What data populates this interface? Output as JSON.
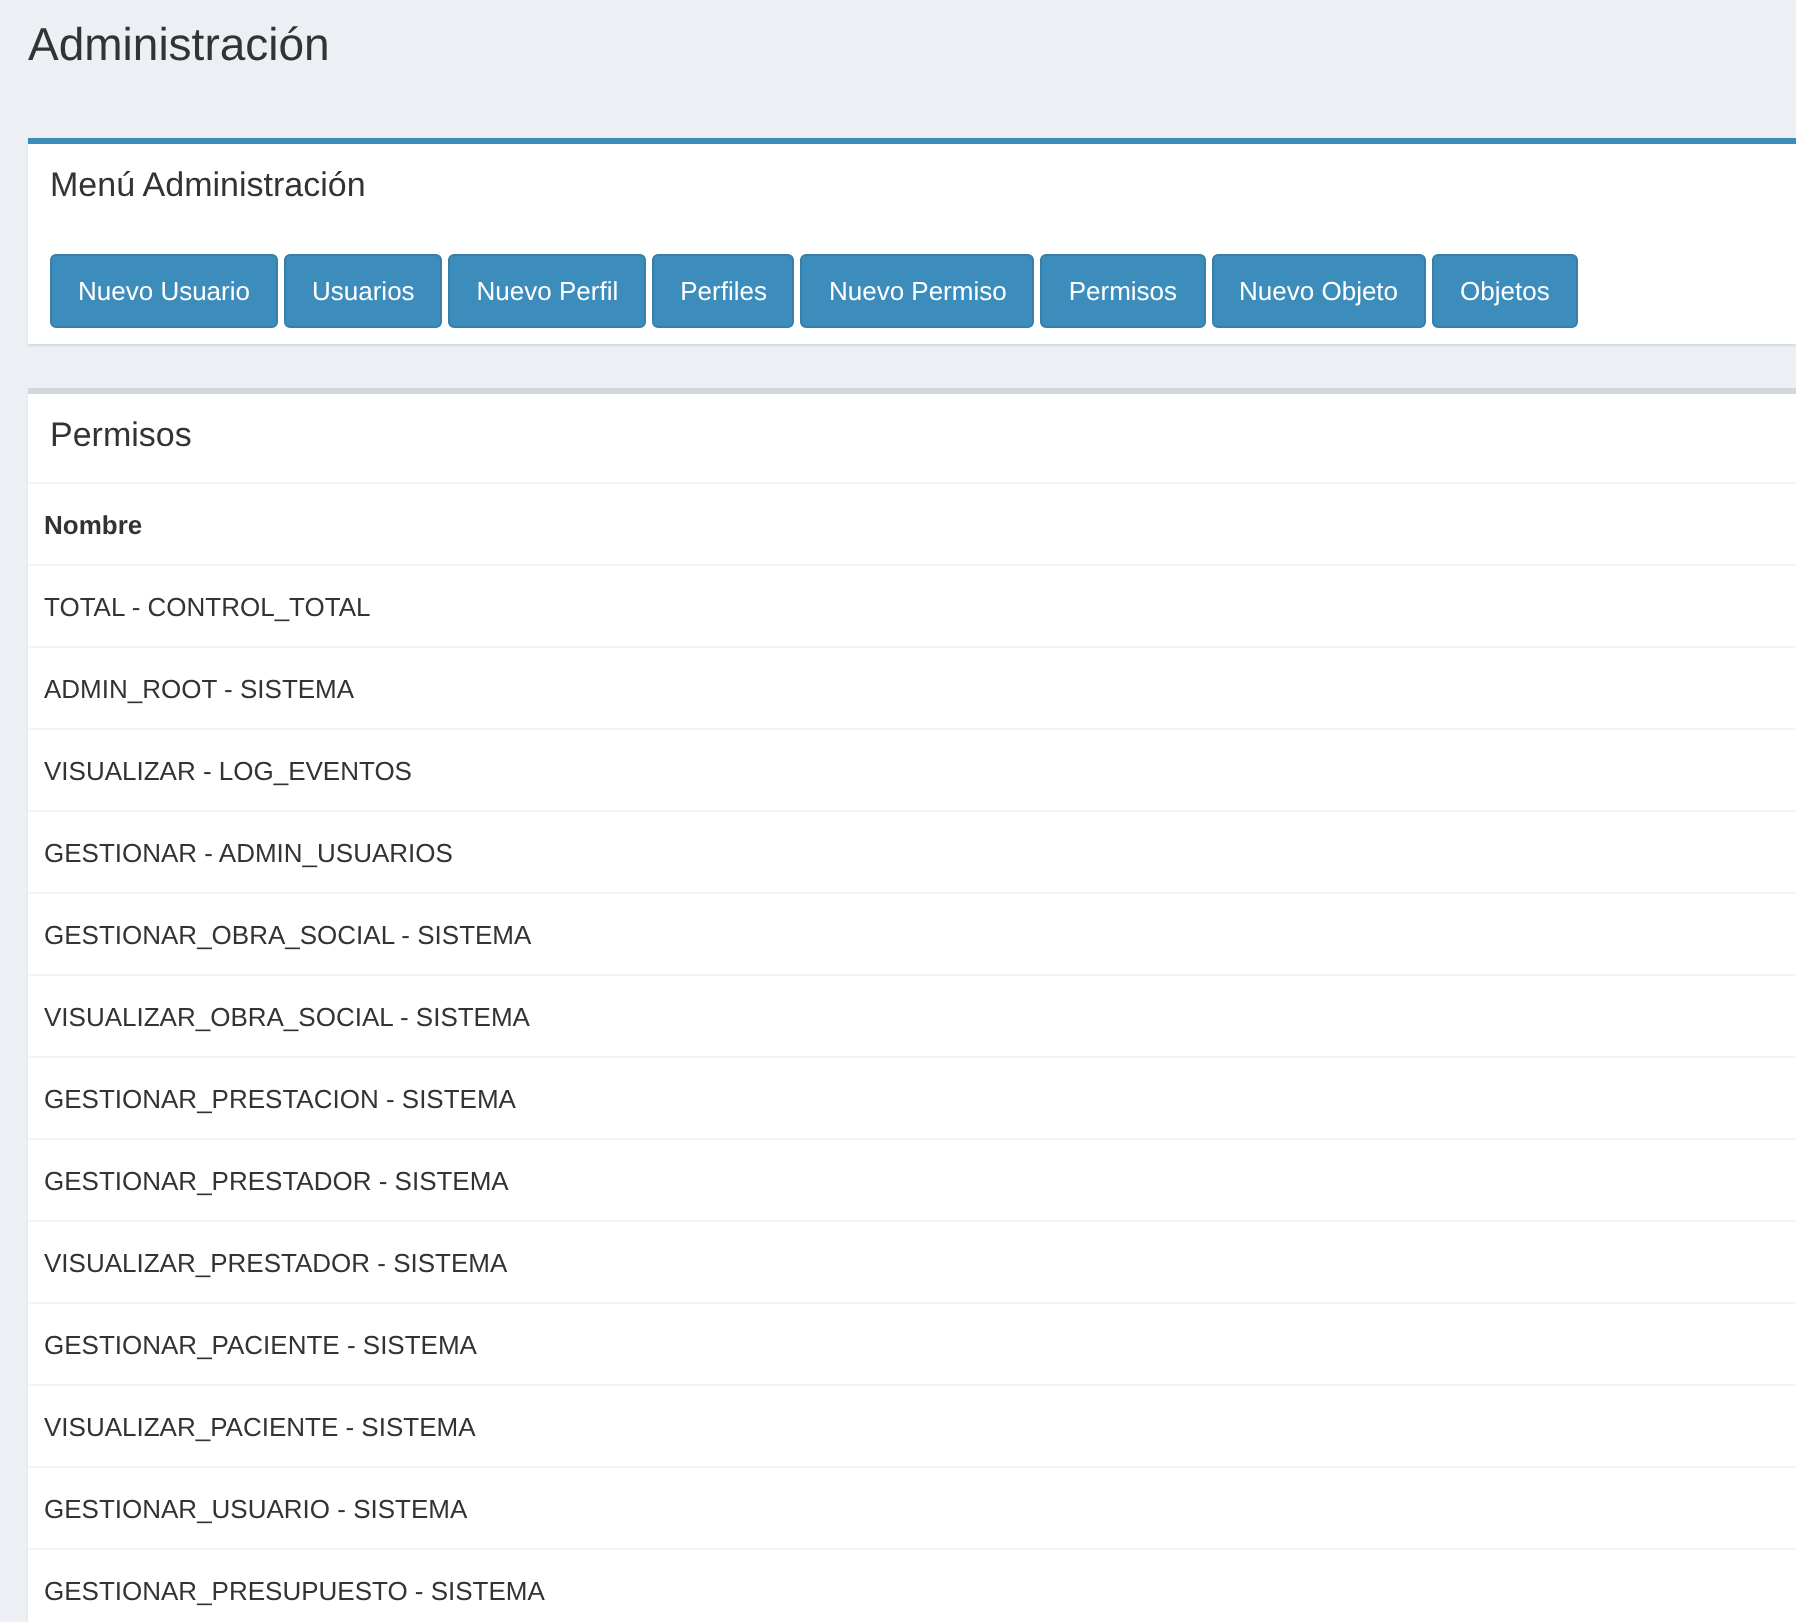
{
  "page_title": "Administración",
  "menu_panel": {
    "title": "Menú Administración",
    "buttons": [
      "Nuevo Usuario",
      "Usuarios",
      "Nuevo Perfil",
      "Perfiles",
      "Nuevo Permiso",
      "Permisos",
      "Nuevo Objeto",
      "Objetos"
    ]
  },
  "permissions_panel": {
    "title": "Permisos",
    "table": {
      "columns": [
        "Nombre"
      ],
      "rows": [
        "TOTAL - CONTROL_TOTAL",
        "ADMIN_ROOT - SISTEMA",
        "VISUALIZAR - LOG_EVENTOS",
        "GESTIONAR - ADMIN_USUARIOS",
        "GESTIONAR_OBRA_SOCIAL - SISTEMA",
        "VISUALIZAR_OBRA_SOCIAL - SISTEMA",
        "GESTIONAR_PRESTACION - SISTEMA",
        "GESTIONAR_PRESTADOR - SISTEMA",
        "VISUALIZAR_PRESTADOR - SISTEMA",
        "GESTIONAR_PACIENTE - SISTEMA",
        "VISUALIZAR_PACIENTE - SISTEMA",
        "GESTIONAR_USUARIO - SISTEMA",
        "GESTIONAR_PRESUPUESTO - SISTEMA"
      ]
    }
  }
}
